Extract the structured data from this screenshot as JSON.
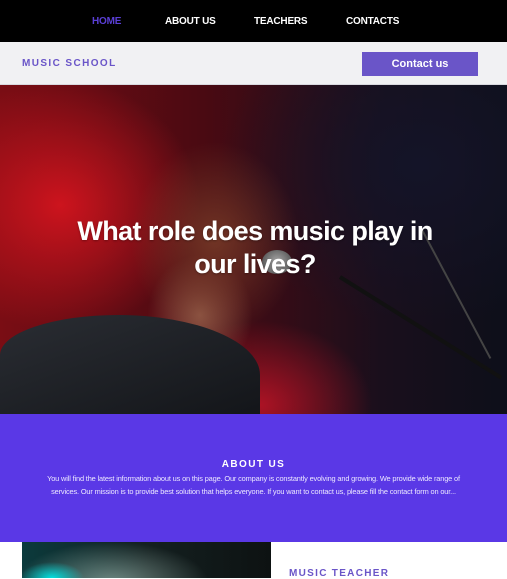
{
  "nav": {
    "items": [
      {
        "label": "HOME",
        "active": true
      },
      {
        "label": "ABOUT US",
        "active": false
      },
      {
        "label": "TEACHERS",
        "active": false
      },
      {
        "label": "CONTACTS",
        "active": false
      }
    ]
  },
  "header": {
    "brand": "MUSIC SCHOOL",
    "contact_button": "Contact us"
  },
  "hero": {
    "title": "What role does music play in our lives?",
    "image": "singer-with-microphone-photo"
  },
  "about": {
    "title": "ABOUT US",
    "text": "You will find the latest information about us on this page. Our company is constantly evolving and growing. We provide wide range of services. Our mission is to provide best solution that helps everyone. If you want to contact us, please fill the contact form on our..."
  },
  "teacher": {
    "title": "MUSIC TEACHER",
    "image": "stage-lights-photo"
  },
  "colors": {
    "accent": "#6a55c8",
    "about_bg": "#5a38e6",
    "nav_bg": "#000000",
    "active_nav": "#5a3fd6"
  }
}
